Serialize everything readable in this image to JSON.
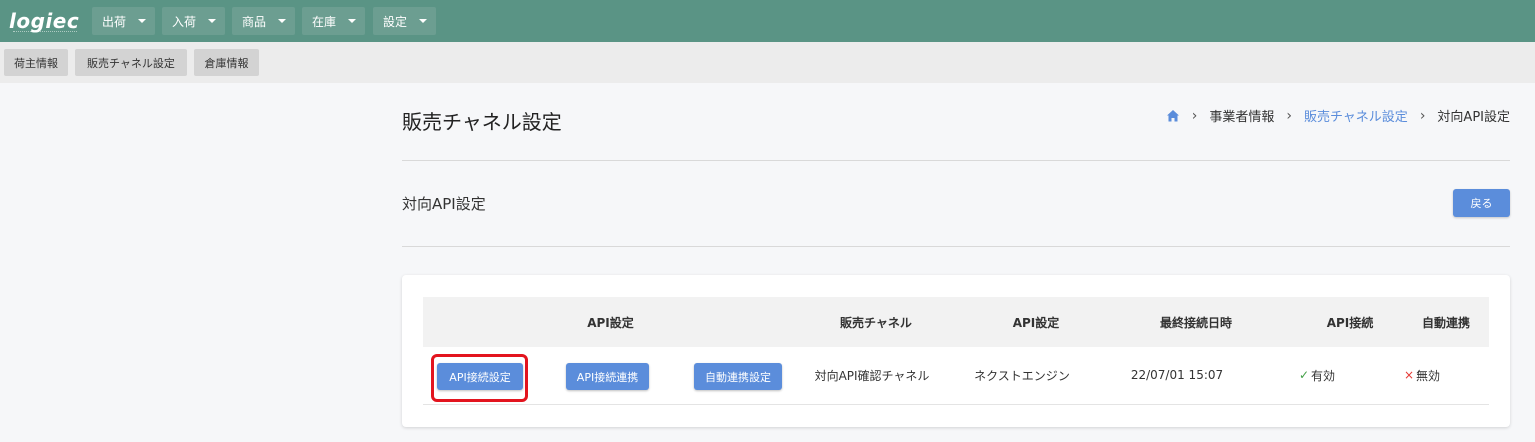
{
  "app": {
    "logo": "logiec"
  },
  "top_nav": [
    {
      "label": "出荷"
    },
    {
      "label": "入荷"
    },
    {
      "label": "商品"
    },
    {
      "label": "在庫"
    },
    {
      "label": "設定"
    }
  ],
  "sub_nav": [
    {
      "label": "荷主情報"
    },
    {
      "label": "販売チャネル設定"
    },
    {
      "label": "倉庫情報"
    }
  ],
  "page": {
    "title": "販売チャネル設定",
    "section_title": "対向API設定",
    "back_label": "戻る"
  },
  "breadcrumb": {
    "home_icon": "home-icon",
    "items": [
      "事業者情報",
      "販売チャネル設定",
      "対向API設定"
    ]
  },
  "table": {
    "headers": [
      "API設定",
      "販売チャネル",
      "API設定",
      "最終接続日時",
      "API接続",
      "自動連携"
    ],
    "row": {
      "buttons": [
        "API接続設定",
        "API接続連携",
        "自動連携設定"
      ],
      "channel": "対向API確認チャネル",
      "api_setting": "ネクストエンジン",
      "last_connected": "22/07/01 15:07",
      "api_connection": "有効",
      "auto_link": "無効"
    }
  },
  "colors": {
    "topbar": "#5a9485",
    "accent": "#5b8ddb",
    "highlight": "#e3141e",
    "enabled": "#43a047",
    "disabled": "#e53935"
  }
}
